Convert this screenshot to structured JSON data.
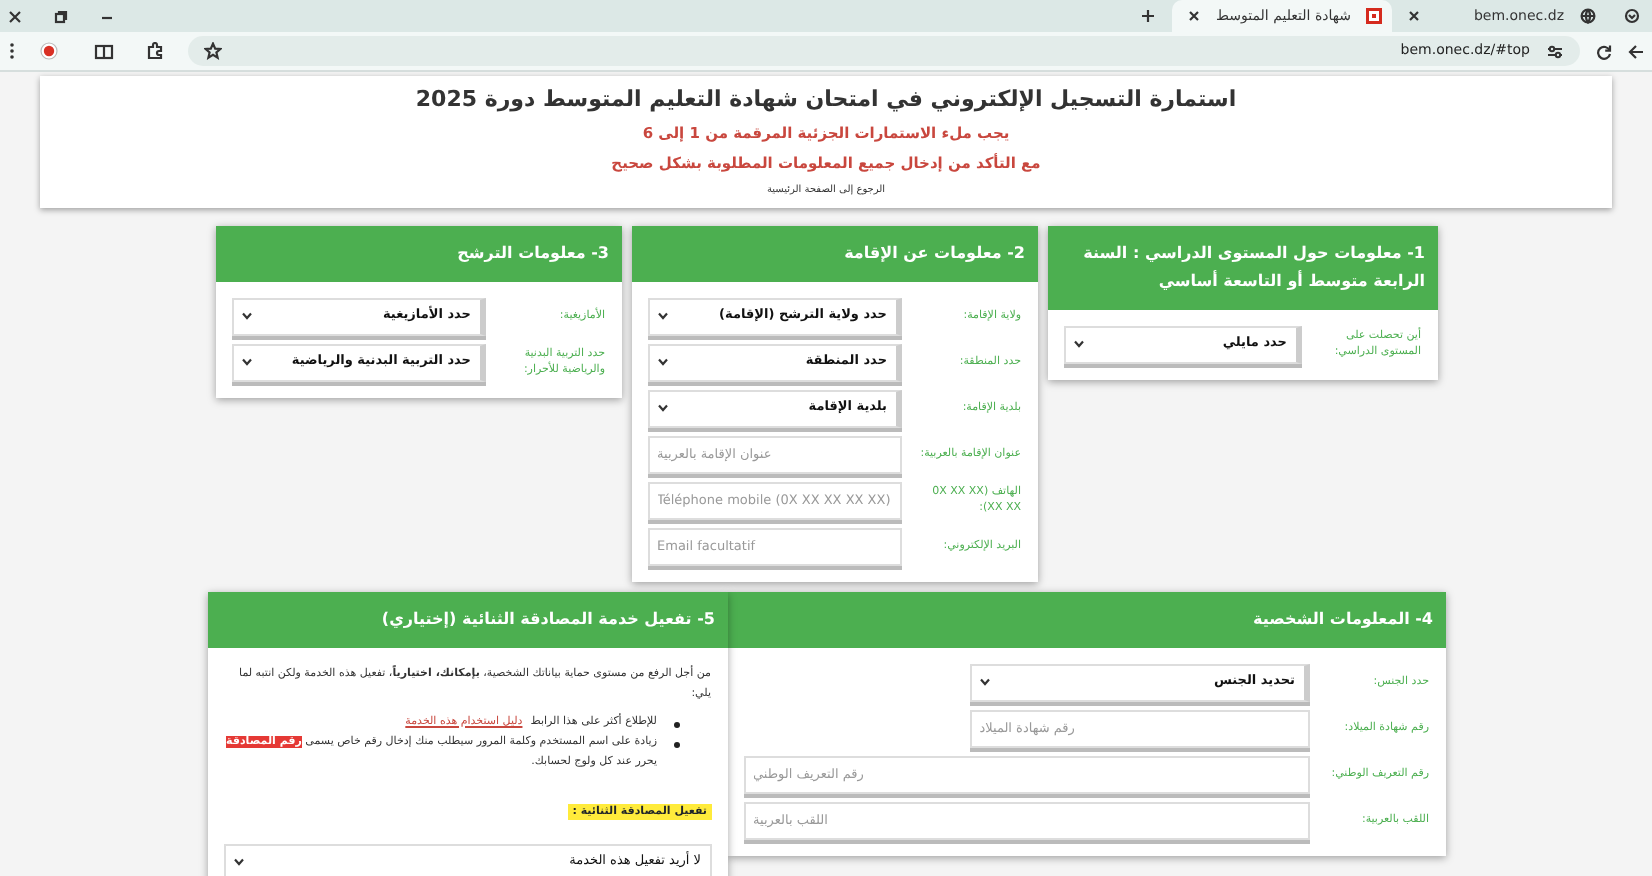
{
  "browser": {
    "tabs": [
      {
        "title": "bem.onec.dz",
        "selected": false
      },
      {
        "title": "شهادة التعليم المتوسط",
        "selected": true
      }
    ],
    "url": "bem.onec.dz/#top"
  },
  "header": {
    "title": "استمارة التسجيل الإلكتروني في امتحان شهادة التعليم المتوسط دورة 2025",
    "notices": [
      "يجب ملء الاستمارات الجزئية المرقمة من 1 إلى 6",
      "مع التأكد من إدخال جميع المعلومات المطلوبة بشكل صحيح"
    ],
    "home_link": "الرجوع إلى الصفحة الرئيسية"
  },
  "rows": [
    {
      "panels": [
        {
          "kind": "form",
          "title": "1- معلومات حول المستوى الدراسي : السنة الرابعة متوسط أو التاسعة أساسي",
          "fields": [
            {
              "kind": "select",
              "label": "أين تحصلت على المستوى الدراسي:",
              "value": "حدد مايلي"
            }
          ]
        },
        {
          "kind": "form",
          "title": "2- معلومات عن الإقامة",
          "fields": [
            {
              "kind": "select",
              "label": "ولاية الإقامة:",
              "value": "حدد ولاية الترشح (الإقامة)"
            },
            {
              "kind": "select",
              "label": "حدد المنطقة:",
              "value": "حدد المنطقة"
            },
            {
              "kind": "select",
              "label": "بلدية الإقامة:",
              "value": "بلدية الإقامة"
            },
            {
              "kind": "input",
              "label": "عنوان الإقامة بالعربية:",
              "placeholder": "عنوان الإقامة بالعربية"
            },
            {
              "kind": "input",
              "label": "الهاتف (0X XX XX XX XX):",
              "placeholder": "Téléphone mobile (0X XX XX XX XX)"
            },
            {
              "kind": "input",
              "label": "البريد الإلكتروني:",
              "placeholder": "Email facultatif"
            }
          ]
        },
        {
          "kind": "form",
          "title": "3- معلومات الترشح",
          "fields": [
            {
              "kind": "select",
              "label": "الأمازيغية:",
              "value": "حدد الأمازيغية"
            },
            {
              "kind": "select",
              "label": "حدد التربية البدنية والرياضية للأحرار:",
              "value": "حدد التربية البدنية والرياضية"
            }
          ]
        }
      ]
    },
    {
      "panels": [
        {
          "kind": "form",
          "title": "4- المعلومات الشخصية",
          "fields": [
            {
              "kind": "select",
              "label": "حدد الجنس:",
              "value": "تحديد الجنس",
              "wide": false
            },
            {
              "kind": "input",
              "label": "رقم شهادة الميلاد:",
              "placeholder": "رقم شهادة الميلاد",
              "wide": false
            },
            {
              "kind": "input",
              "label": "رقم التعريف الوطني:",
              "placeholder": "رقم التعريف الوطني",
              "wide": true
            },
            {
              "kind": "input",
              "label": "اللقب بالعربية:",
              "placeholder": "اللقب بالعربية",
              "wide": true
            }
          ]
        },
        {
          "kind": "info",
          "title": "5- تفعيل خدمة المصادقة الثنائية (إختياري)",
          "intro": "من أجل الرفع من مستوى حماية بياناتك الشخصية، **بإمكانك، اختيارياً**، تفعيل هذه الخدمة ولكن انتبه لما يلي:",
          "bullets": [
            {
              "text": "للإطلاع أكثر على هذا الرابط",
              "link": "دليل استخدام هذه الخدمة"
            },
            {
              "text": "زيادة على اسم المستخدم وكلمة المرور سيطلب منك إدخال رقم خاص يسمى **رقم المصادقة** يحرر عند كل ولوج لحسابك."
            }
          ],
          "option_label": "تفعيل المصادقة الثنائية :",
          "select_value": "لا أريد تفعيل هذه الخدمة"
        }
      ]
    }
  ]
}
